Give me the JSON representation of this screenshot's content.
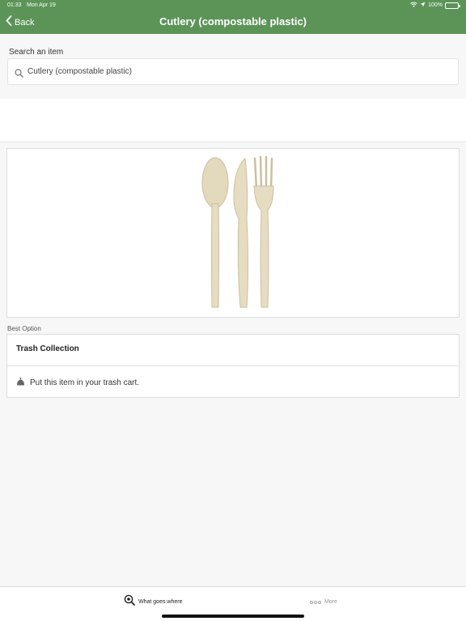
{
  "status_bar": {
    "time": "01:33",
    "date": "Mon Apr 19",
    "battery": "100%",
    "icons": [
      "wifi-icon",
      "location-icon",
      "battery-icon"
    ]
  },
  "nav": {
    "back_label": "Back",
    "title": "Cutlery (compostable plastic)",
    "color": "#5c9458"
  },
  "search": {
    "label": "Search an item",
    "value": "Cutlery (compostable plastic)",
    "icon": "search-icon"
  },
  "item_image": {
    "icon": "cutlery-image"
  },
  "best_option": {
    "section_label": "Best Option",
    "title": "Trash Collection",
    "instruction": "Put this item in your trash cart.",
    "icon": "trash-bag-icon"
  },
  "tab_bar": {
    "tabs": [
      {
        "label": "What goes where",
        "icon": "magnifier-icon",
        "active": true
      },
      {
        "label": "More",
        "icon": "more-dots-icon",
        "active": false
      }
    ]
  }
}
